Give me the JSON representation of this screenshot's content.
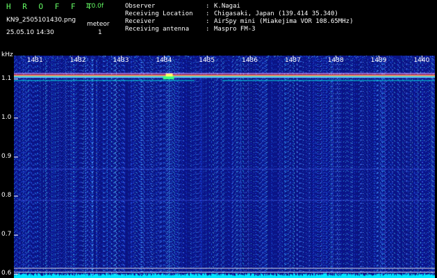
{
  "header": {
    "app_title": "H R O F F T",
    "version": "1.0.0f",
    "filename": "KN9_2505101430.png",
    "timestamp": "25.05.10 14:30",
    "meteor_label": "meteor",
    "meteor_count": "1"
  },
  "info": [
    {
      "label": "Observer",
      "value": "K.Nagai"
    },
    {
      "label": "Receiving Location",
      "value": "Chigasaki, Japan (139.414 35.340)"
    },
    {
      "label": "Receiver",
      "value": "AirSpy mini (Miakejima VOR 108.65MHz)"
    },
    {
      "label": "Receiving antenna",
      "value": "Maspro FM-3"
    }
  ],
  "chart_data": {
    "type": "heatmap",
    "ylabel": "kHz",
    "x_ticks": [
      "1431",
      "1432",
      "1433",
      "1434",
      "1435",
      "1436",
      "1437",
      "1438",
      "1439",
      "1440"
    ],
    "y_ticks": [
      "1.1",
      "1.0",
      "0.9",
      "0.8",
      "0.7",
      "0.6"
    ],
    "ylim": [
      0.59,
      1.16
    ],
    "features": {
      "carrier_line_khz": 1.11,
      "secondary_line_khz": 1.097,
      "meteor_echo_time": 1434.1
    },
    "colors": {
      "background": "#0a1480",
      "noise": "#2a4ad8",
      "carrier": "#ff6060",
      "trace": "#00e0e0",
      "baseline": "#00e8ff"
    }
  }
}
